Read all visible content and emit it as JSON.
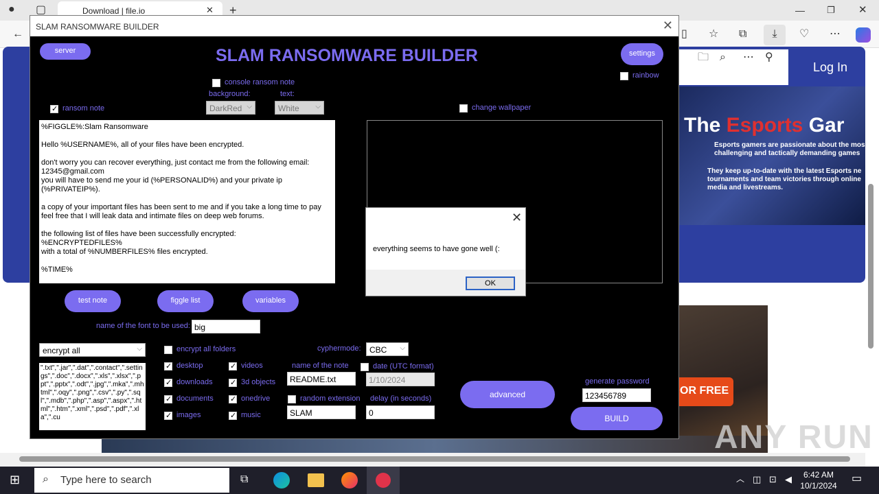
{
  "browser": {
    "tab_title": "Download | file.io",
    "login_label": "Log In"
  },
  "webpage": {
    "esports_title_a": "The ",
    "esports_title_b": "Esports",
    "esports_title_c": " Gar",
    "esports_sub1": "Esports gamers are passionate about the mos challenging and tactically demanding games",
    "esports_sub2": "They keep up-to-date with the latest Esports ne tournaments and team victories through online media and livestreams.",
    "play_free": "OR FREE",
    "watermark": "ANY RUN"
  },
  "app": {
    "window_title": "SLAM RANSOMWARE BUILDER",
    "heading": "SLAM RANSOMWARE BUILDER",
    "server_label": "server",
    "settings_label": "settings",
    "rainbow_label": "rainbow",
    "console_ransom_note_label": "console ransom note",
    "background_label": "background:",
    "text_label": "text:",
    "background_value": "DarkRed",
    "text_value": "White",
    "ransom_note_label": "ransom note",
    "change_wallpaper_label": "change wallpaper",
    "note_text": "%FIGGLE%:Slam Ransomware\n\nHello %USERNAME%, all of your files have been encrypted.\n\ndon't worry you can recover everything, just contact me from the following email:\n12345@gmail.com\nyou will have to send me your id (%PERSONALID%) and your private ip (%PRIVATEIP%).\n\na copy of your important files has been sent to me and if you take a long time to pay\nfeel free that I will leak data and intimate files on deep web forums.\n\nthe following list of files have been successfully encrypted:\n%ENCRYPTEDFILES%\nwith a total of %NUMBERFILES% files encrypted.\n\n%TIME%",
    "test_note_label": "test note",
    "figgle_list_label": "figgle list",
    "variables_label": "variables",
    "font_name_label": "name of the font to be used:",
    "font_name_value": "big",
    "encrypt_mode_value": "encrypt all",
    "extensions_text": "\".txt\",\".jar\",\".dat\",\".contact\",\".settings\",\".doc\",\".docx\",\".xls\",\".xlsx\",\".ppt\",\".pptx\",\".odt\",\".jpg\",\".mka\",\".mhtml\",\".oqy\",\".png\",\".csv\",\".py\",\".sql\",\".mdb\",\".php\",\".asp\",\".aspx\",\".html\",\".htm\",\".xml\",\".psd\",\".pdf\",\".xla\",\".cu",
    "encrypt_all_folders_label": "encrypt all folders",
    "desktop_label": "desktop",
    "downloads_label": "downloads",
    "documents_label": "documents",
    "images_label": "images",
    "videos_label": "videos",
    "objects3d_label": "3d objects",
    "onedrive_label": "onedrive",
    "music_label": "music",
    "cyphermode_label": "cyphermode:",
    "cyphermode_value": "CBC",
    "note_name_label": "name of the note",
    "note_name_value": "README.txt",
    "date_label": "date (UTC format)",
    "date_value": "1/10/2024",
    "random_ext_label": "random extension",
    "random_ext_value": "SLAM",
    "delay_label": "delay (in seconds)",
    "delay_value": "0",
    "advanced_label": "advanced",
    "generate_password_label": "generate password",
    "password_value": "123456789",
    "build_label": "BUILD"
  },
  "dialog": {
    "message": "everything seems to have gone well (:",
    "ok_label": "OK"
  },
  "taskbar": {
    "search_placeholder": "Type here to search",
    "time": "6:42 AM",
    "date": "10/1/2024"
  }
}
